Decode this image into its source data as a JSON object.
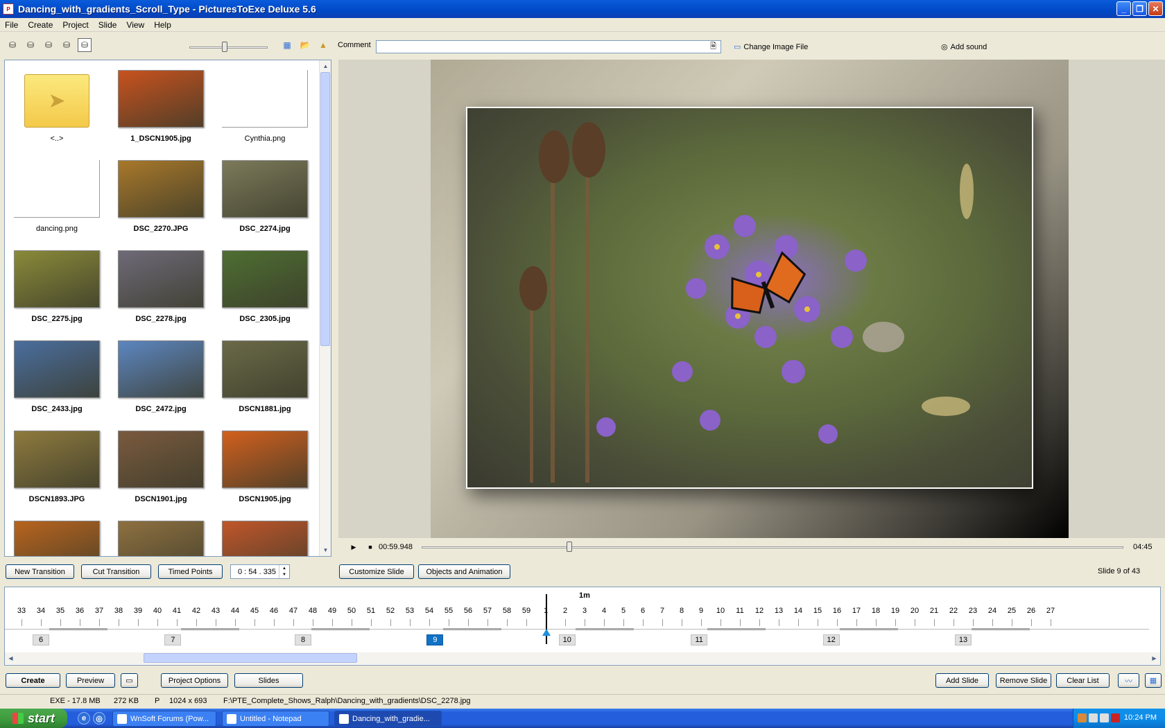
{
  "window": {
    "title": "Dancing_with_gradients_Scroll_Type - PicturesToExe Deluxe 5.6",
    "app_icon": "pte-app-icon"
  },
  "menu": [
    "File",
    "Create",
    "Project",
    "Slide",
    "View",
    "Help"
  ],
  "toolbar": {
    "drives": [
      "A:",
      "C:",
      "D:",
      "E:",
      "F:"
    ],
    "comment_label": "Comment",
    "comment_value": "",
    "change_image_label": "Change Image File",
    "add_sound_label": "Add sound",
    "thumb_size_level": 0.45
  },
  "browser": {
    "items": [
      {
        "label": "<..>",
        "type": "folder",
        "bold": false
      },
      {
        "label": "1_DSCN1905.jpg",
        "type": "image",
        "bold": true,
        "color": "#C8521E"
      },
      {
        "label": "Cynthia.png",
        "type": "blank",
        "bold": false
      },
      {
        "label": "dancing.png",
        "type": "blank",
        "bold": false
      },
      {
        "label": "DSC_2270.JPG",
        "type": "image",
        "bold": true,
        "color": "#A8782A"
      },
      {
        "label": "DSC_2274.jpg",
        "type": "image",
        "bold": true,
        "color": "#7C7A5A"
      },
      {
        "label": "DSC_2275.jpg",
        "type": "image",
        "bold": true,
        "color": "#8A8A3A"
      },
      {
        "label": "DSC_2278.jpg",
        "type": "image",
        "bold": true,
        "color": "#6E6A78"
      },
      {
        "label": "DSC_2305.jpg",
        "type": "image",
        "bold": true,
        "color": "#4E6E32"
      },
      {
        "label": "DSC_2433.jpg",
        "type": "image",
        "bold": true,
        "color": "#4A6E9E"
      },
      {
        "label": "DSC_2472.jpg",
        "type": "image",
        "bold": true,
        "color": "#5C86C0"
      },
      {
        "label": "DSCN1881.jpg",
        "type": "image",
        "bold": true,
        "color": "#6A6A48"
      },
      {
        "label": "DSCN1893.JPG",
        "type": "image",
        "bold": true,
        "color": "#8E7A3E"
      },
      {
        "label": "DSCN1901.jpg",
        "type": "image",
        "bold": true,
        "color": "#7A5A3E"
      },
      {
        "label": "DSCN1905.jpg",
        "type": "image",
        "bold": true,
        "color": "#D2601E"
      },
      {
        "label": "",
        "type": "image",
        "bold": true,
        "color": "#B8641E"
      },
      {
        "label": "",
        "type": "image",
        "bold": true,
        "color": "#8E7040"
      },
      {
        "label": "",
        "type": "image",
        "bold": true,
        "color": "#C0562A"
      }
    ]
  },
  "playback": {
    "current_time": "00:59.948",
    "total_time": "04:45",
    "position": 0.21
  },
  "controls": {
    "new_transition": "New Transition",
    "cut_transition": "Cut Transition",
    "timed_points": "Timed Points",
    "spin_value": "0 : 54 . 335",
    "customize_slide": "Customize Slide",
    "objects_animation": "Objects and Animation",
    "slide_count": "Slide 9 of 43"
  },
  "timeline": {
    "minute_label": "1m",
    "seconds_labels": [
      "33",
      "34",
      "35",
      "36",
      "37",
      "38",
      "39",
      "40",
      "41",
      "42",
      "43",
      "44",
      "45",
      "46",
      "47",
      "48",
      "49",
      "50",
      "51",
      "52",
      "53",
      "54",
      "55",
      "56",
      "57",
      "58",
      "59",
      "1",
      "2",
      "3",
      "4",
      "5",
      "6",
      "7",
      "8",
      "9",
      "10",
      "11",
      "12",
      "13",
      "14",
      "15",
      "16",
      "17",
      "18",
      "19",
      "20",
      "21",
      "22",
      "23",
      "24",
      "25",
      "26",
      "27"
    ],
    "slides": [
      {
        "num": "6",
        "sec": 34,
        "active": false
      },
      {
        "num": "7",
        "sec": 40.8,
        "active": false
      },
      {
        "num": "8",
        "sec": 47.5,
        "active": false
      },
      {
        "num": "9",
        "sec": 54.3,
        "active": true
      },
      {
        "num": "10",
        "sec": 61.1,
        "active": false
      },
      {
        "num": "11",
        "sec": 67.9,
        "active": false
      },
      {
        "num": "12",
        "sec": 74.7,
        "active": false
      },
      {
        "num": "13",
        "sec": 81.5,
        "active": false
      }
    ],
    "cursor_sec": 60
  },
  "bottom": {
    "create": "Create",
    "preview": "Preview",
    "project_options": "Project Options",
    "slides": "Slides",
    "add_slide": "Add Slide",
    "remove_slide": "Remove Slide",
    "clear_list": "Clear List"
  },
  "status": {
    "exe_size": "EXE - 17.8 MB",
    "file_size": "272 KB",
    "flag": "P",
    "dimensions": "1024 x 693",
    "path": "F:\\PTE_Complete_Shows_Ralph\\Dancing_with_gradients\\DSC_2278.jpg"
  },
  "taskbar": {
    "start": "start",
    "tasks": [
      {
        "label": "WnSoft Forums (Pow...",
        "active": false
      },
      {
        "label": "Untitled - Notepad",
        "active": false
      },
      {
        "label": "Dancing_with_gradie...",
        "active": true
      }
    ],
    "clock": "10:24 PM"
  }
}
